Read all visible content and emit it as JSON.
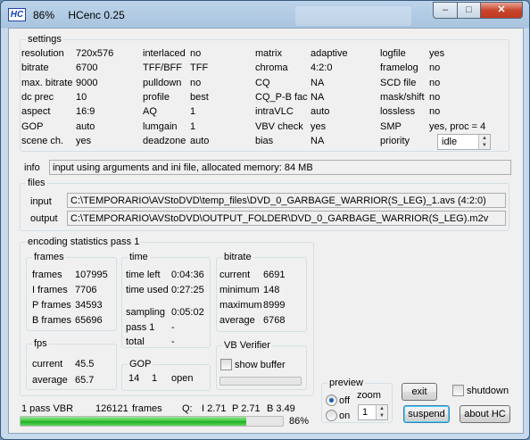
{
  "title": {
    "icon_text": "HC",
    "percent": "86%",
    "app": "HCenc 0.25"
  },
  "window_buttons": {
    "min": "–",
    "max": "□",
    "close": "✕"
  },
  "settings": {
    "label": "settings",
    "col1": [
      [
        "resolution",
        "720x576"
      ],
      [
        "bitrate",
        "6700"
      ],
      [
        "max. bitrate",
        "9000"
      ],
      [
        "dc prec",
        "10"
      ],
      [
        "aspect",
        "16:9"
      ],
      [
        "GOP",
        "auto"
      ],
      [
        "scene ch.",
        "yes"
      ]
    ],
    "col2": [
      [
        "interlaced",
        "no"
      ],
      [
        "TFF/BFF",
        "TFF"
      ],
      [
        "pulldown",
        "no"
      ],
      [
        "profile",
        "best"
      ],
      [
        "AQ",
        "1"
      ],
      [
        "lumgain",
        "1"
      ],
      [
        "deadzone",
        "auto"
      ]
    ],
    "col3": [
      [
        "matrix",
        "adaptive"
      ],
      [
        "chroma",
        "4:2:0"
      ],
      [
        "CQ",
        "NA"
      ],
      [
        "CQ_P-B fac",
        "NA"
      ],
      [
        "intraVLC",
        "auto"
      ],
      [
        "VBV check",
        "yes"
      ],
      [
        "bias",
        "NA"
      ]
    ],
    "col4": [
      [
        "logfile",
        "yes"
      ],
      [
        "framelog",
        "no"
      ],
      [
        "SCD file",
        "no"
      ],
      [
        "mask/shift",
        "no"
      ],
      [
        "lossless",
        "no"
      ],
      [
        "SMP",
        "yes,  proc = 4"
      ],
      [
        "priority",
        ""
      ]
    ],
    "priority_value": "idle"
  },
  "info": {
    "label": "info",
    "value": "input using arguments and ini file,  allocated memory:  84 MB"
  },
  "files": {
    "label": "files",
    "input_label": "input",
    "input_value": "C:\\TEMPORARIO\\AVStoDVD\\temp_files\\DVD_0_GARBAGE_WARRIOR(S_LEG)_1.avs  (4:2:0)",
    "output_label": "output",
    "output_value": "C:\\TEMPORARIO\\AVStoDVD\\OUTPUT_FOLDER\\DVD_0_GARBAGE_WARRIOR(S_LEG).m2v"
  },
  "stats": {
    "label": "encoding statistics pass 1",
    "frames": {
      "label": "frames",
      "rows": [
        [
          "frames",
          "107995"
        ],
        [
          "I frames",
          "7706"
        ],
        [
          "P frames",
          "34593"
        ],
        [
          "B frames",
          "65696"
        ]
      ]
    },
    "time": {
      "label": "time",
      "rows": [
        [
          "time left",
          "0:04:36"
        ],
        [
          "time used",
          "0:27:25"
        ],
        [
          "sampling",
          "0:05:02"
        ],
        [
          "pass 1",
          "-"
        ],
        [
          "total",
          "-"
        ]
      ]
    },
    "bitrate": {
      "label": "bitrate",
      "rows": [
        [
          "current",
          "6691"
        ],
        [
          "minimum",
          "148"
        ],
        [
          "maximum",
          "8999"
        ],
        [
          "average",
          "6768"
        ]
      ]
    },
    "fps": {
      "label": "fps",
      "rows": [
        [
          "current",
          "45.5"
        ],
        [
          "average",
          "65.7"
        ]
      ]
    },
    "gop": {
      "label": "GOP",
      "a": "14",
      "b": "1",
      "c": "open"
    },
    "vb": {
      "label": "VB Verifier",
      "show_buffer": "show buffer"
    }
  },
  "preview": {
    "label": "preview",
    "off": "off",
    "on": "on",
    "zoom_label": "zoom",
    "zoom_value": "1"
  },
  "buttons": {
    "exit": "exit",
    "shutdown": "shutdown",
    "suspend": "suspend",
    "about": "about  HC"
  },
  "status": {
    "mode": "1 pass VBR",
    "frames_count": "126121",
    "frames_word": "frames",
    "q": "Q:",
    "i": "I 2.71",
    "p": "P 2.71",
    "b": "B 3.49",
    "progress_text": "86%",
    "progress": 0.86
  }
}
